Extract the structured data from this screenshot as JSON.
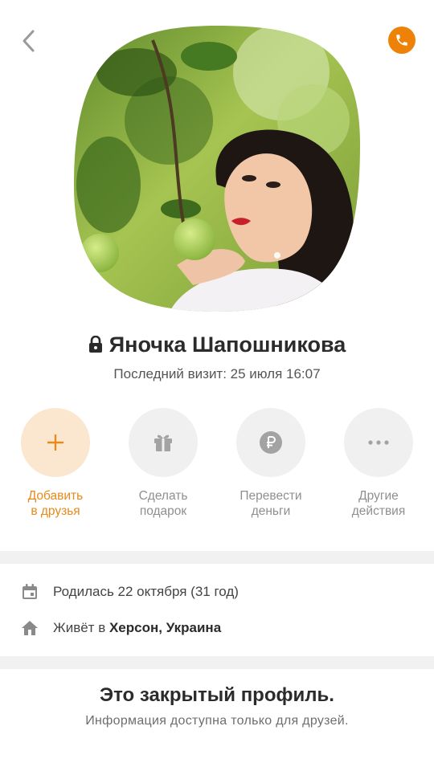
{
  "header": {
    "back_icon": "chevron-left-icon",
    "call_icon": "phone-icon",
    "accent_color": "#ee8208"
  },
  "profile": {
    "name": "Яночка Шапошникова",
    "lock_icon": "lock-icon",
    "last_visit": "Последний визит: 25 июля 16:07"
  },
  "actions": [
    {
      "line1": "Добавить",
      "line2": "в друзья",
      "icon": "plus-icon"
    },
    {
      "line1": "Сделать",
      "line2": "подарок",
      "icon": "gift-icon"
    },
    {
      "line1": "Перевести",
      "line2": "деньги",
      "icon": "ruble-icon"
    },
    {
      "line1": "Другие",
      "line2": "действия",
      "icon": "more-icon"
    }
  ],
  "info": {
    "birthday": "Родилась 22 октября (31 год)",
    "lives_prefix": "Живёт в",
    "lives_place": "Херсон, Украина"
  },
  "closed_profile": {
    "title": "Это закрытый профиль.",
    "subtitle": "Информация доступна только для друзей."
  }
}
